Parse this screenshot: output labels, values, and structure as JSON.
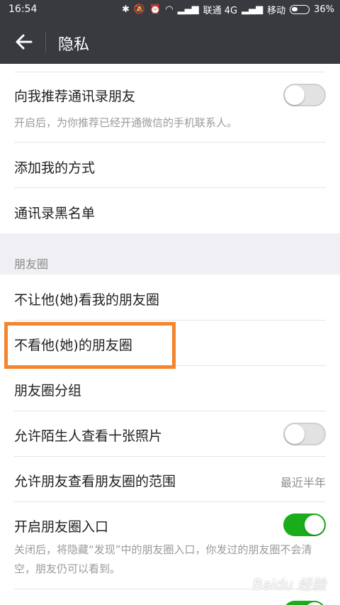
{
  "status": {
    "time": "16:54",
    "carrier1": "联通 4G",
    "carrier2": "移动",
    "battery": "36%"
  },
  "header": {
    "title": "隐私"
  },
  "items": {
    "recommend": {
      "label": "向我推荐通讯录朋友",
      "desc": "开启后，为你推荐已经开通微信的手机联系人。",
      "enabled": false
    },
    "add_method": {
      "label": "添加我的方式"
    },
    "blacklist": {
      "label": "通讯录黑名单"
    },
    "moments_section": "朋友圈",
    "hide_from": {
      "label": "不让他(她)看我的朋友圈"
    },
    "dont_see": {
      "label": "不看他(她)的朋友圈"
    },
    "groups": {
      "label": "朋友圈分组"
    },
    "strangers": {
      "label": "允许陌生人查看十张照片",
      "enabled": false
    },
    "range": {
      "label": "允许朋友查看朋友圈的范围",
      "value": "最近半年"
    },
    "entry": {
      "label": "开启朋友圈入口",
      "desc": "关闭后，将隐藏“发现”中的朋友圈入口，你发过的朋友圈不会清空，朋友仍可以看到。",
      "enabled": true
    }
  },
  "colors": {
    "accent": "#1aad19",
    "highlight": "#f5852d",
    "header_bg": "#393a3f"
  },
  "watermark": "Baidu 经验"
}
